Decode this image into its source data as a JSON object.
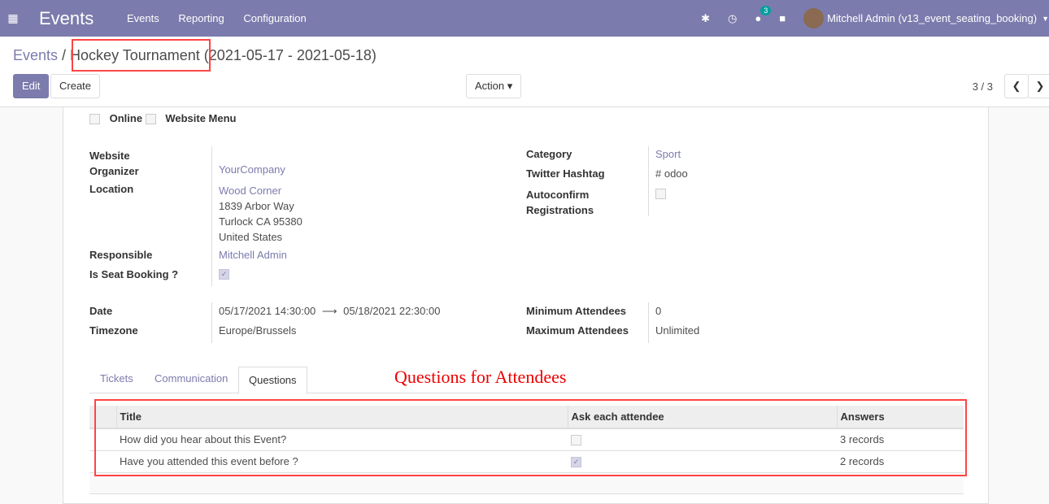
{
  "nav": {
    "app": "Events",
    "menu": [
      "Events",
      "Reporting",
      "Configuration"
    ],
    "chat_count": "3",
    "user": "Mitchell Admin (v13_event_seating_booking)"
  },
  "breadcrumb": {
    "parent": "Events",
    "current": "Hockey Tournament (2021-05-17 - 2021-05-18)"
  },
  "toolbar": {
    "edit": "Edit",
    "create": "Create",
    "action": "Action",
    "pager": "3 / 3"
  },
  "form": {
    "online": "Online",
    "website_menu": "Website Menu",
    "organizer_label": "Website Organizer",
    "organizer": "YourCompany",
    "location_label": "Location",
    "location_name": "Wood Corner",
    "addr1": "1839 Arbor Way",
    "addr2": "Turlock CA 95380",
    "addr3": "United States",
    "responsible_label": "Responsible",
    "responsible": "Mitchell Admin",
    "seat_label": "Is Seat Booking ?",
    "category_label": "Category",
    "category": "Sport",
    "hashtag_label": "Twitter Hashtag",
    "hashtag": "# odoo",
    "autoconfirm_label": "Autoconfirm Registrations",
    "date_label": "Date",
    "date_start": "05/17/2021 14:30:00",
    "date_end": "05/18/2021 22:30:00",
    "tz_label": "Timezone",
    "tz": "Europe/Brussels",
    "min_label": "Minimum Attendees",
    "min": "0",
    "max_label": "Maximum Attendees",
    "max": "Unlimited"
  },
  "tabs": [
    "Tickets",
    "Communication",
    "Questions"
  ],
  "annotation": "Questions for Attendees",
  "table": {
    "headers": [
      "Title",
      "Ask each attendee",
      "Answers"
    ],
    "rows": [
      {
        "title": "How did you hear about this Event?",
        "ask": false,
        "answers": "3 records"
      },
      {
        "title": "Have you attended this event before ?",
        "ask": true,
        "answers": "2 records"
      }
    ]
  }
}
